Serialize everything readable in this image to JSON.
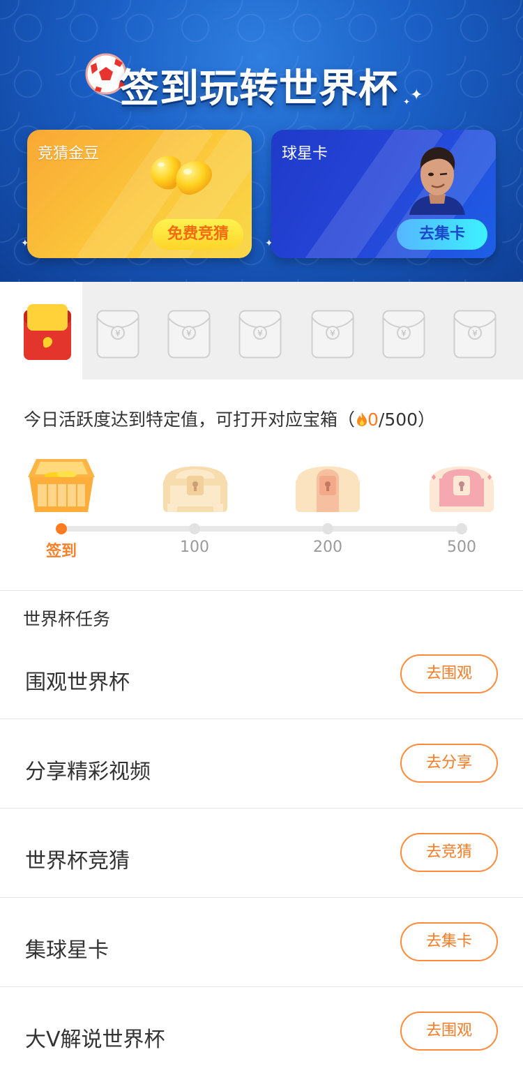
{
  "banner": {
    "title": "签到玩转世界杯",
    "cards": [
      {
        "title": "竞猜金豆",
        "button": "免费竞猜"
      },
      {
        "title": "球星卡",
        "button": "去集卡"
      }
    ]
  },
  "packets": {
    "active_index": 0,
    "items": [
      "¥",
      "¥",
      "¥",
      "¥",
      "¥",
      "¥"
    ]
  },
  "activity": {
    "text": "今日活跃度达到特定值，可打开对应宝箱（",
    "current": "0",
    "total": "/500）",
    "steps": [
      "签到",
      "100",
      "200",
      "500"
    ]
  },
  "tasks": {
    "section_title": "世界杯任务",
    "items": [
      {
        "name": "围观世界杯",
        "button": "去围观"
      },
      {
        "name": "分享精彩视频",
        "button": "去分享"
      },
      {
        "name": "世界杯竞猜",
        "button": "去竞猜"
      },
      {
        "name": "集球星卡",
        "button": "去集卡"
      },
      {
        "name": "大V解说世界杯",
        "button": "去围观"
      }
    ]
  },
  "colors": {
    "accent": "#ff7b21",
    "banner_blue": "#1a5ec4"
  }
}
